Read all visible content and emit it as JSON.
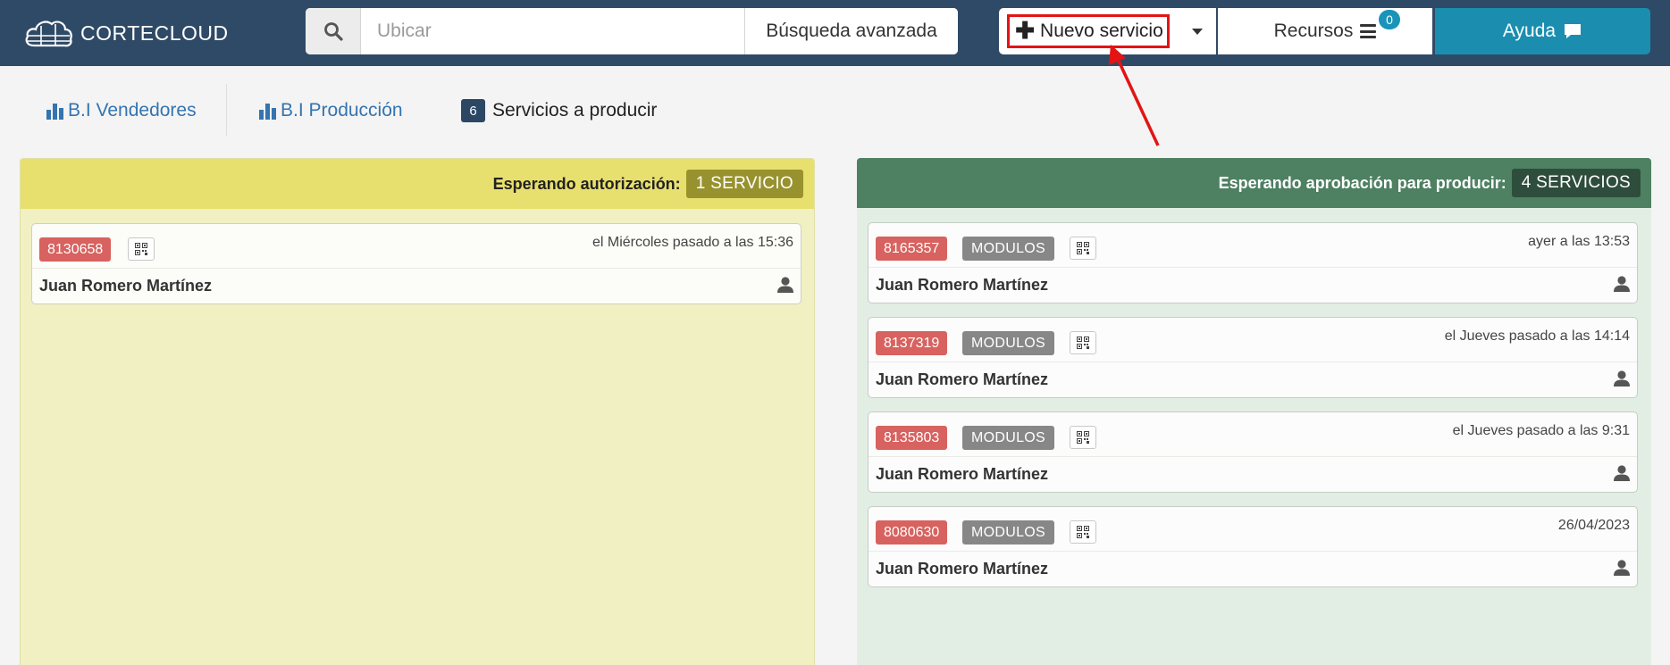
{
  "header": {
    "logo_text": "CORTECLOUD",
    "search_placeholder": "Ubicar",
    "advanced_search_label": "Búsqueda avanzada",
    "new_service_label": "Nuevo servicio",
    "resources_label": "Recursos",
    "resources_badge": "0",
    "help_label": "Ayuda"
  },
  "tabs": [
    {
      "label": "B.I Vendedores"
    },
    {
      "label": "B.I Producción"
    },
    {
      "label": "Servicios a producir",
      "count": "6"
    }
  ],
  "panels": {
    "left": {
      "title": "Esperando autorización:",
      "badge": "1 SERVICIO",
      "cards": [
        {
          "id": "8130658",
          "time": "el Miércoles pasado a las 15:36",
          "name": "Juan Romero Martínez"
        }
      ]
    },
    "right": {
      "title": "Esperando aprobación para producir:",
      "badge": "4 SERVICIOS",
      "cards": [
        {
          "id": "8165357",
          "tag": "MODULOS",
          "time": "ayer a las 13:53",
          "name": "Juan Romero Martínez"
        },
        {
          "id": "8137319",
          "tag": "MODULOS",
          "time": "el Jueves pasado a las 14:14",
          "name": "Juan Romero Martínez"
        },
        {
          "id": "8135803",
          "tag": "MODULOS",
          "time": "el Jueves pasado a las 9:31",
          "name": "Juan Romero Martínez"
        },
        {
          "id": "8080630",
          "tag": "MODULOS",
          "time": "26/04/2023",
          "name": "Juan Romero Martínez"
        }
      ]
    }
  },
  "icons": {
    "logo": "cloud-logo-icon",
    "search": "search-icon",
    "plus": "plus-icon",
    "caret": "caret-down-icon",
    "resources": "hamburger-icon",
    "help": "chat-bubble-icon",
    "tab_chart": "bar-chart-icon",
    "qr": "qr-code-icon",
    "user": "user-icon",
    "annotation": "red-arrow-annotation"
  },
  "colors": {
    "topbar": "#2f4a66",
    "help_button": "#1b8eb0",
    "left_panel_header": "#e8e06e",
    "right_panel_header": "#4e8062",
    "id_badge": "#d7625f",
    "annotation": "#e31414"
  }
}
